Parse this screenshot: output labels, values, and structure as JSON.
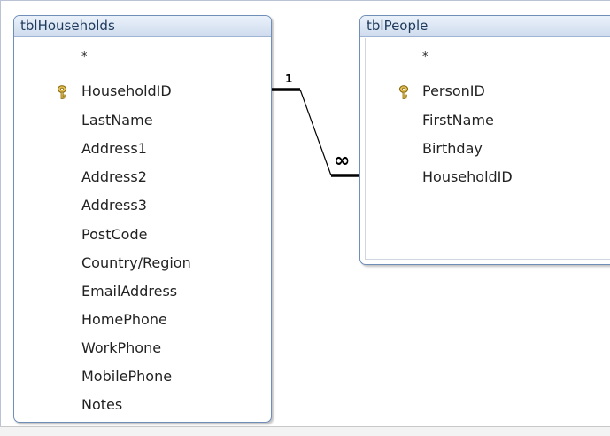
{
  "tables": [
    {
      "name": "tblHouseholds",
      "fields": [
        "*",
        "HouseholdID",
        "LastName",
        "Address1",
        "Address2",
        "Address3",
        "PostCode",
        "Country/Region",
        "EmailAddress",
        "HomePhone",
        "WorkPhone",
        "MobilePhone",
        "Notes"
      ],
      "primary_key": "HouseholdID"
    },
    {
      "name": "tblPeople",
      "fields": [
        "*",
        "PersonID",
        "FirstName",
        "Birthday",
        "HouseholdID"
      ],
      "primary_key": "PersonID"
    }
  ],
  "relationship": {
    "from_table": "tblHouseholds",
    "from_field": "HouseholdID",
    "to_table": "tblPeople",
    "to_field": "HouseholdID",
    "one_label": "1",
    "many_label": "∞"
  },
  "icons": {
    "key": "key-icon"
  },
  "colors": {
    "title_bar": "#cfdcee",
    "border": "#6f8fb8"
  }
}
